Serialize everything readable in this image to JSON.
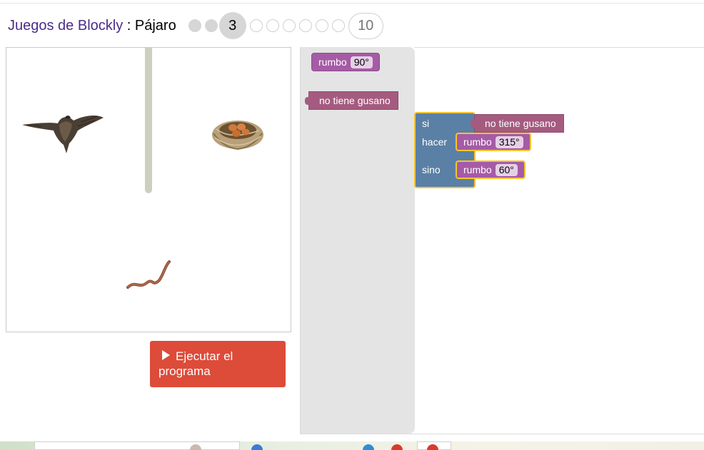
{
  "header": {
    "app_title": "Juegos de Blockly",
    "separator": " : ",
    "game_name": "Pájaro",
    "levels": {
      "done_count": 2,
      "current": "3",
      "todo_count": 6,
      "last": "10"
    }
  },
  "visualization": {
    "bird": "bird",
    "nest": "nest-with-eggs",
    "worm": "worm",
    "wall": "wall"
  },
  "run_button": {
    "label": "Ejecutar el programa",
    "icon": "play-icon"
  },
  "toolbox": {
    "blocks": [
      {
        "type": "rumbo",
        "label": "rumbo",
        "value": "90°"
      },
      {
        "type": "sensor",
        "label": "no tiene gusano"
      }
    ]
  },
  "workspace": {
    "if_block": {
      "if_label": "si",
      "condition": "no tiene gusano",
      "do_label": "hacer",
      "do_block": {
        "label": "rumbo",
        "value": "315°"
      },
      "else_label": "sino",
      "else_block": {
        "label": "rumbo",
        "value": "60°"
      }
    }
  },
  "colors": {
    "rumbo_block": "#a55ba5",
    "sensor_block": "#a55b80",
    "if_block": "#5b80a5",
    "selection": "#f4c430",
    "run_button": "#dd4b39",
    "title": "#4a2d8a"
  }
}
